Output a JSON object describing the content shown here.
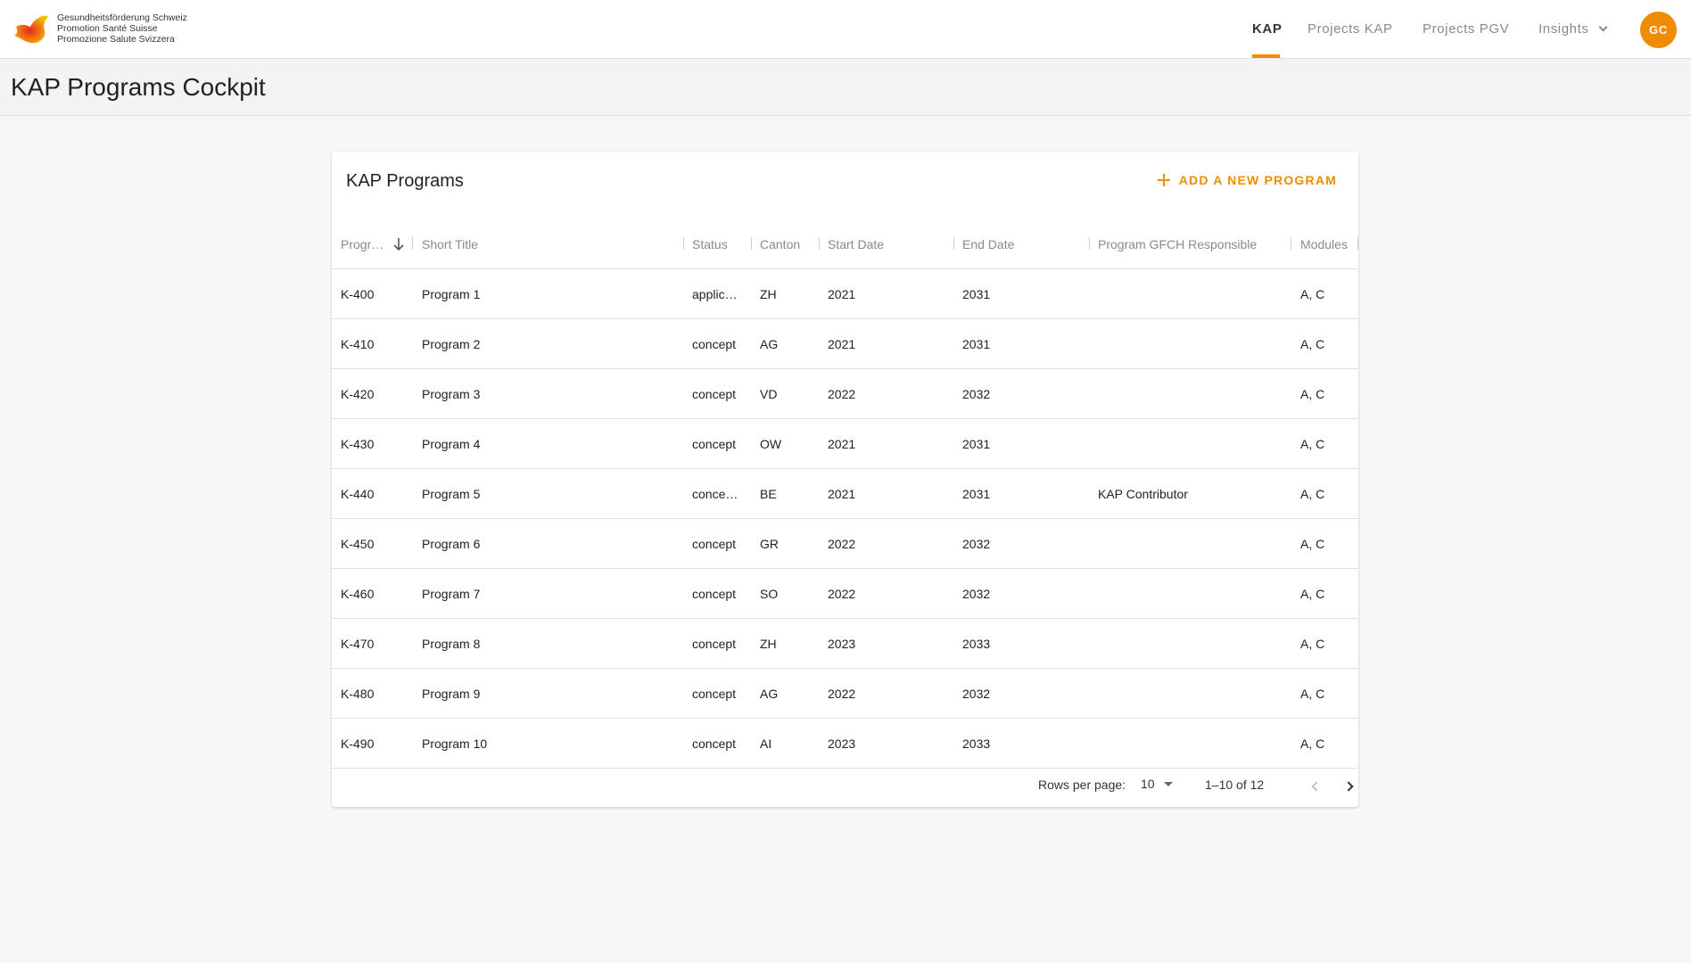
{
  "header": {
    "logo_lines": [
      "Gesundheitsförderung Schweiz",
      "Promotion Santé Suisse",
      "Promozione Salute Svizzera"
    ],
    "nav": [
      {
        "label": "KAP",
        "active": true
      },
      {
        "label": "Projects KAP",
        "active": false
      },
      {
        "label": "Projects PGV",
        "active": false
      },
      {
        "label": "Insights",
        "active": false
      }
    ],
    "avatar_initials": "GC"
  },
  "page": {
    "title": "KAP Programs Cockpit"
  },
  "card": {
    "title": "KAP Programs",
    "add_button_label": "ADD A NEW PROGRAM"
  },
  "table": {
    "columns": [
      "Progr…",
      "Short Title",
      "Status",
      "Canton",
      "Start Date",
      "End Date",
      "Program GFCH Responsible",
      "Modules"
    ],
    "rows": [
      [
        "K-400",
        "Program 1",
        "applic…",
        "ZH",
        "2021",
        "2031",
        "",
        "A, C"
      ],
      [
        "K-410",
        "Program 2",
        "concept",
        "AG",
        "2021",
        "2031",
        "",
        "A, C"
      ],
      [
        "K-420",
        "Program 3",
        "concept",
        "VD",
        "2022",
        "2032",
        "",
        "A, C"
      ],
      [
        "K-430",
        "Program 4",
        "concept",
        "OW",
        "2021",
        "2031",
        "",
        "A, C"
      ],
      [
        "K-440",
        "Program 5",
        "conce…",
        "BE",
        "2021",
        "2031",
        "KAP Contributor",
        "A, C"
      ],
      [
        "K-450",
        "Program 6",
        "concept",
        "GR",
        "2022",
        "2032",
        "",
        "A, C"
      ],
      [
        "K-460",
        "Program 7",
        "concept",
        "SO",
        "2022",
        "2032",
        "",
        "A, C"
      ],
      [
        "K-470",
        "Program 8",
        "concept",
        "ZH",
        "2023",
        "2033",
        "",
        "A, C"
      ],
      [
        "K-480",
        "Program 9",
        "concept",
        "AG",
        "2022",
        "2032",
        "",
        "A, C"
      ],
      [
        "K-490",
        "Program 10",
        "concept",
        "AI",
        "2023",
        "2033",
        "",
        "A, C"
      ]
    ]
  },
  "pagination": {
    "rows_per_page_label": "Rows per page:",
    "rows_per_page_value": "10",
    "range": "1–10 of 12"
  },
  "colors": {
    "accent": "#ef8c00"
  }
}
